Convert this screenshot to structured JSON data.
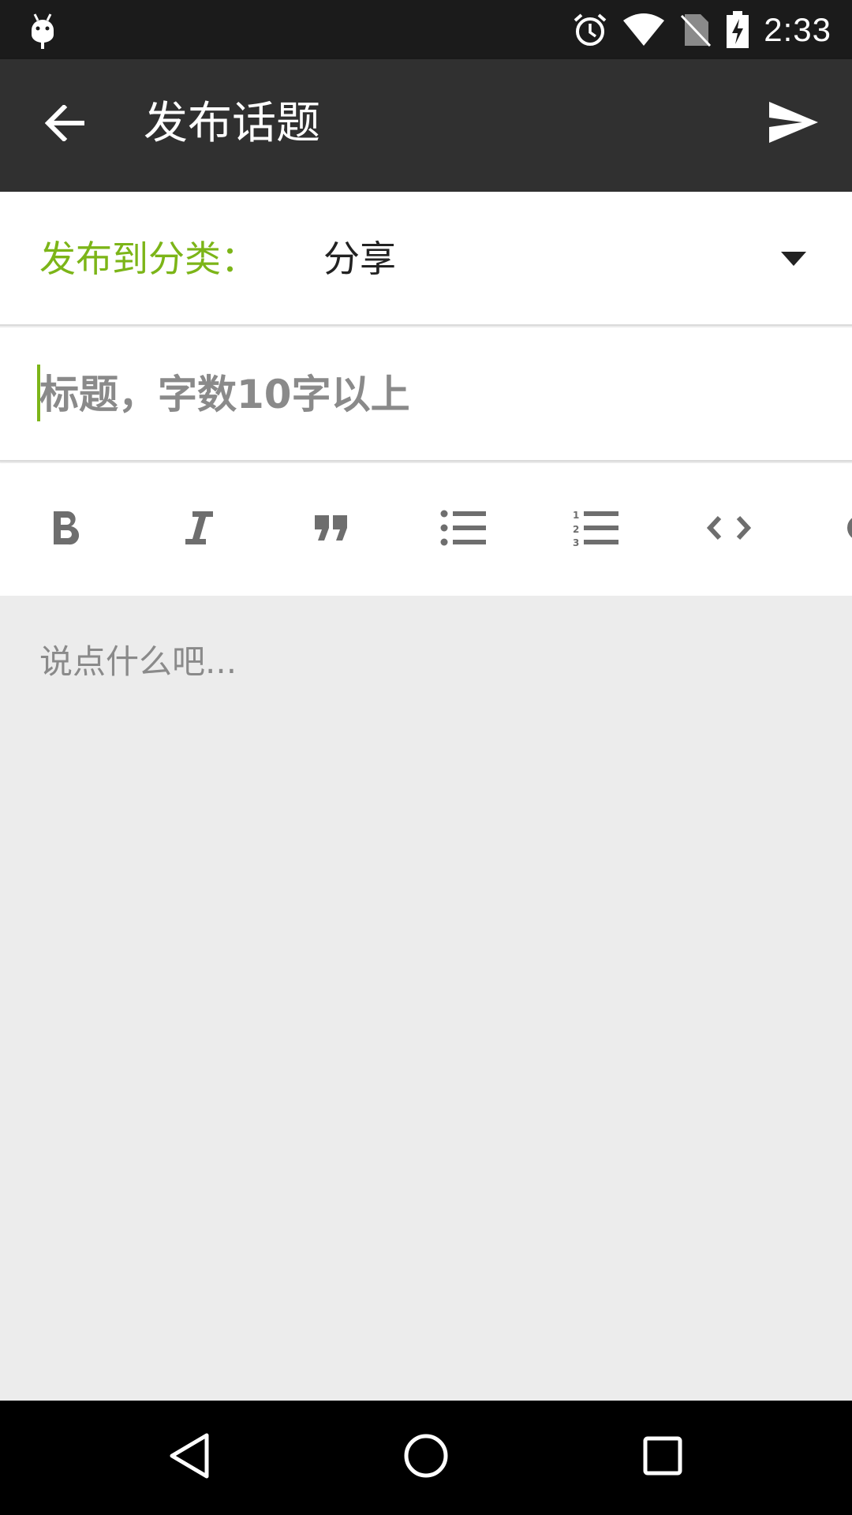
{
  "status_bar": {
    "time": "2:33",
    "icons": [
      "android-debug-icon",
      "alarm-icon",
      "wifi-icon",
      "no-sim-icon",
      "battery-charging-icon"
    ]
  },
  "app_bar": {
    "title": "发布话题",
    "back_icon": "arrow-back-icon",
    "send_icon": "send-icon"
  },
  "category": {
    "label": "发布到分类：",
    "selected": "分享"
  },
  "title_input": {
    "placeholder": "标题，字数10字以上",
    "value": ""
  },
  "toolbar": {
    "tools": [
      "bold-icon",
      "italic-icon",
      "quote-icon",
      "bulleted-list-icon",
      "numbered-list-icon",
      "code-icon",
      "more-icon"
    ]
  },
  "content_input": {
    "placeholder": "说点什么吧...",
    "value": ""
  },
  "colors": {
    "accent": "#7cb518",
    "app_bar": "#303030",
    "status_bar": "#1b1b1b",
    "background": "#ececec"
  }
}
